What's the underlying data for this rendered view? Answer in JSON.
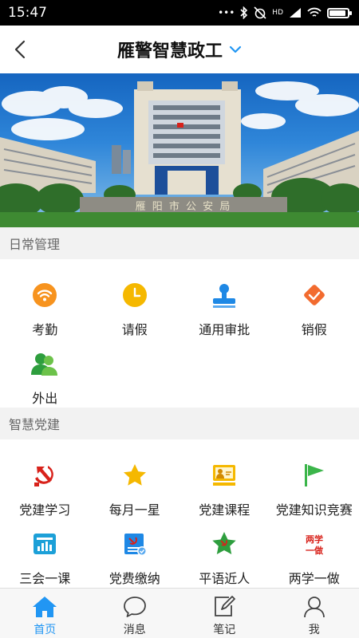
{
  "status_bar": {
    "time": "15:47",
    "network_label": "HD"
  },
  "nav": {
    "title": "雁警智慧政工"
  },
  "banner": {
    "sign_text": "雁 阳 市 公 安 局"
  },
  "sections": [
    {
      "title": "日常管理",
      "items": [
        {
          "label": "考勤",
          "icon": "wifi-icon",
          "color": "#f7931e"
        },
        {
          "label": "请假",
          "icon": "clock-icon",
          "color": "#f5b800"
        },
        {
          "label": "通用审批",
          "icon": "stamp-icon",
          "color": "#1e88e5"
        },
        {
          "label": "销假",
          "icon": "handshake-icon",
          "color": "#f26b2f"
        },
        {
          "label": "外出",
          "icon": "people-icon",
          "color": "#2e9e3e"
        }
      ]
    },
    {
      "title": "智慧党建",
      "items": [
        {
          "label": "党建学习",
          "icon": "hammer-sickle-icon",
          "color": "#d8221b"
        },
        {
          "label": "每月一星",
          "icon": "star-icon",
          "color": "#f5b800"
        },
        {
          "label": "党建课程",
          "icon": "presentation-icon",
          "color": "#f5b800"
        },
        {
          "label": "党建知识竞赛",
          "icon": "flag-icon",
          "color": "#3bb54a"
        },
        {
          "label": "三会一课",
          "icon": "chart-board-icon",
          "color": "#1ca0d8"
        },
        {
          "label": "党费缴纳",
          "icon": "party-fee-icon",
          "color": "#1e88e5"
        },
        {
          "label": "平语近人",
          "icon": "star-badge-icon",
          "color": "#2e9e3e"
        },
        {
          "label": "两学一做",
          "icon": "two-study-logo",
          "color": "#d8221b",
          "logo_text": "两学一做"
        }
      ]
    }
  ],
  "tabs": [
    {
      "label": "首页",
      "icon": "home-icon",
      "active": true
    },
    {
      "label": "消息",
      "icon": "message-icon",
      "active": false
    },
    {
      "label": "笔记",
      "icon": "note-edit-icon",
      "active": false
    },
    {
      "label": "我",
      "icon": "user-icon",
      "active": false
    }
  ],
  "colors": {
    "accent": "#2196f3",
    "status_bar": "#000000",
    "section_bg": "#f2f2f2"
  }
}
